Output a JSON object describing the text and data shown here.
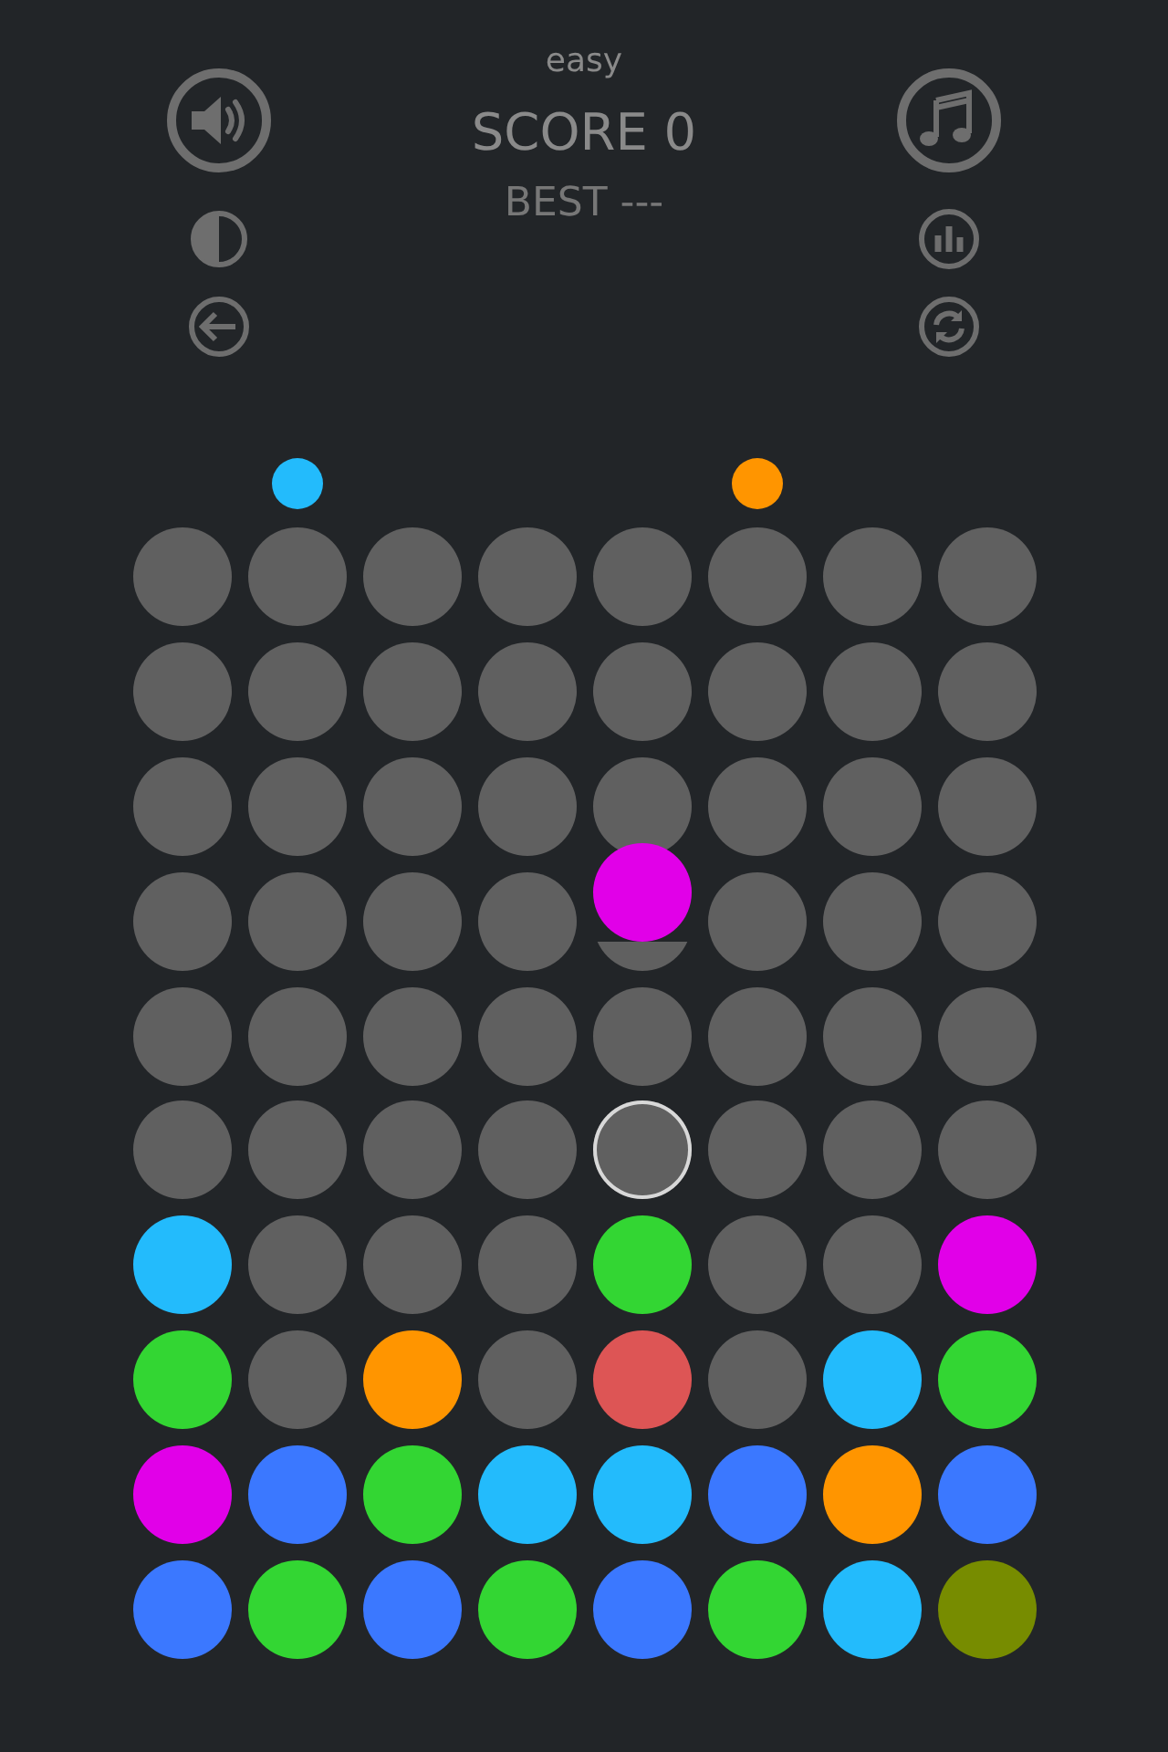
{
  "header": {
    "difficulty": "easy",
    "score": "SCORE 0",
    "best": "BEST ---"
  },
  "next_row": [
    {
      "kind": "empty"
    },
    {
      "kind": "ball",
      "color": "#23bbfc"
    },
    {
      "kind": "empty"
    },
    {
      "kind": "empty"
    },
    {
      "kind": "empty"
    },
    {
      "kind": "ball",
      "color": "#ff9500"
    },
    {
      "kind": "empty"
    },
    {
      "kind": "empty"
    }
  ],
  "board": [
    [
      {
        "kind": "empty",
        "selected": false
      },
      {
        "kind": "empty",
        "selected": false
      },
      {
        "kind": "empty",
        "selected": false
      },
      {
        "kind": "empty",
        "selected": false
      },
      {
        "kind": "empty",
        "selected": false
      },
      {
        "kind": "empty",
        "selected": false
      },
      {
        "kind": "empty",
        "selected": false
      },
      {
        "kind": "empty",
        "selected": false
      }
    ],
    [
      {
        "kind": "empty",
        "selected": false
      },
      {
        "kind": "empty",
        "selected": false
      },
      {
        "kind": "empty",
        "selected": false
      },
      {
        "kind": "empty",
        "selected": false
      },
      {
        "kind": "empty",
        "selected": false
      },
      {
        "kind": "empty",
        "selected": false
      },
      {
        "kind": "empty",
        "selected": false
      },
      {
        "kind": "empty",
        "selected": false
      }
    ],
    [
      {
        "kind": "empty",
        "selected": false
      },
      {
        "kind": "empty",
        "selected": false
      },
      {
        "kind": "empty",
        "selected": false
      },
      {
        "kind": "empty",
        "selected": false
      },
      {
        "kind": "empty",
        "selected": false
      },
      {
        "kind": "empty",
        "selected": false
      },
      {
        "kind": "empty",
        "selected": false
      },
      {
        "kind": "empty",
        "selected": false
      }
    ],
    [
      {
        "kind": "empty",
        "selected": false
      },
      {
        "kind": "empty",
        "selected": false
      },
      {
        "kind": "empty",
        "selected": false
      },
      {
        "kind": "empty",
        "selected": false
      },
      {
        "kind": "empty",
        "selected": false,
        "falling": {
          "color": "#e100e8"
        }
      },
      {
        "kind": "empty",
        "selected": false
      },
      {
        "kind": "empty",
        "selected": false
      },
      {
        "kind": "empty",
        "selected": false
      }
    ],
    [
      {
        "kind": "empty",
        "selected": false
      },
      {
        "kind": "empty",
        "selected": false
      },
      {
        "kind": "empty",
        "selected": false
      },
      {
        "kind": "empty",
        "selected": false
      },
      {
        "kind": "empty",
        "selected": false
      },
      {
        "kind": "empty",
        "selected": false
      },
      {
        "kind": "empty",
        "selected": false
      },
      {
        "kind": "empty",
        "selected": false
      }
    ],
    [
      {
        "kind": "empty",
        "selected": false
      },
      {
        "kind": "empty",
        "selected": false
      },
      {
        "kind": "empty",
        "selected": false
      },
      {
        "kind": "empty",
        "selected": false
      },
      {
        "kind": "empty",
        "selected": true
      },
      {
        "kind": "empty",
        "selected": false
      },
      {
        "kind": "empty",
        "selected": false
      },
      {
        "kind": "empty",
        "selected": false
      }
    ],
    [
      {
        "kind": "ball",
        "color": "#23bbfc",
        "selected": false
      },
      {
        "kind": "empty",
        "selected": false
      },
      {
        "kind": "empty",
        "selected": false
      },
      {
        "kind": "empty",
        "selected": false
      },
      {
        "kind": "ball",
        "color": "#33d633",
        "selected": false
      },
      {
        "kind": "empty",
        "selected": false
      },
      {
        "kind": "empty",
        "selected": false
      },
      {
        "kind": "ball",
        "color": "#e100e8",
        "selected": false
      }
    ],
    [
      {
        "kind": "ball",
        "color": "#33d633",
        "selected": false
      },
      {
        "kind": "empty",
        "selected": false
      },
      {
        "kind": "ball",
        "color": "#ff9500",
        "selected": false
      },
      {
        "kind": "empty",
        "selected": false
      },
      {
        "kind": "ball",
        "color": "#dd5555",
        "selected": false
      },
      {
        "kind": "empty",
        "selected": false
      },
      {
        "kind": "ball",
        "color": "#23bbfc",
        "selected": false
      },
      {
        "kind": "ball",
        "color": "#33d633",
        "selected": false
      }
    ],
    [
      {
        "kind": "ball",
        "color": "#e100e8",
        "selected": false
      },
      {
        "kind": "ball",
        "color": "#3b78ff",
        "selected": false
      },
      {
        "kind": "ball",
        "color": "#33d633",
        "selected": false
      },
      {
        "kind": "ball",
        "color": "#23bbfc",
        "selected": false
      },
      {
        "kind": "ball",
        "color": "#23bbfc",
        "selected": false
      },
      {
        "kind": "ball",
        "color": "#3b78ff",
        "selected": false
      },
      {
        "kind": "ball",
        "color": "#ff9500",
        "selected": false
      },
      {
        "kind": "ball",
        "color": "#3b78ff",
        "selected": false
      }
    ],
    [
      {
        "kind": "ball",
        "color": "#3b78ff",
        "selected": false
      },
      {
        "kind": "ball",
        "color": "#33d633",
        "selected": false
      },
      {
        "kind": "ball",
        "color": "#3b78ff",
        "selected": false
      },
      {
        "kind": "ball",
        "color": "#33d633",
        "selected": false
      },
      {
        "kind": "ball",
        "color": "#3b78ff",
        "selected": false
      },
      {
        "kind": "ball",
        "color": "#33d633",
        "selected": false
      },
      {
        "kind": "ball",
        "color": "#23bbfc",
        "selected": false
      },
      {
        "kind": "ball",
        "color": "#778c00",
        "selected": false
      }
    ]
  ]
}
